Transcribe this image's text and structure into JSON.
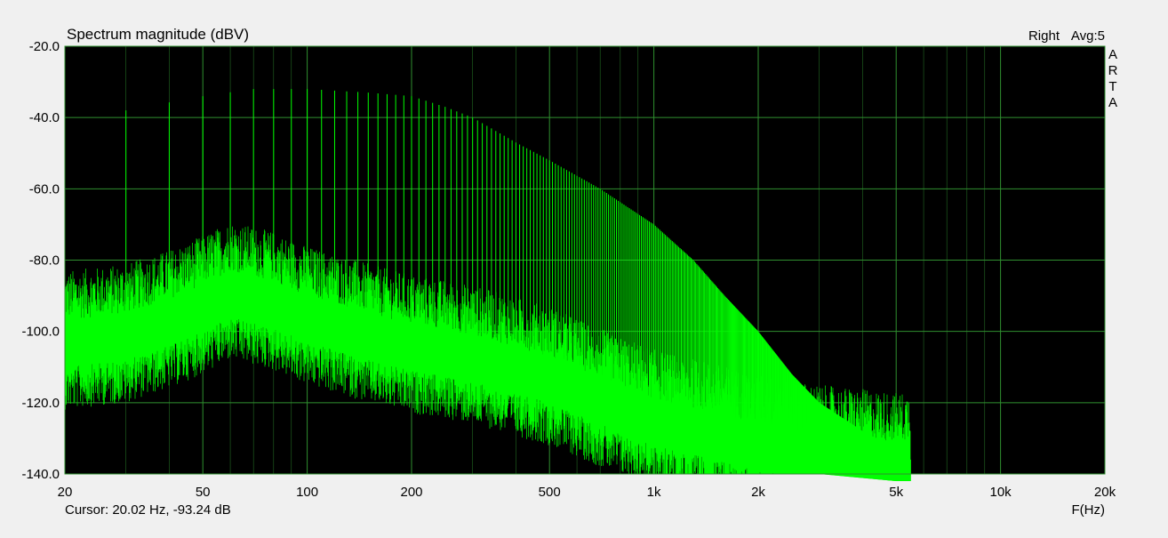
{
  "chart_data": {
    "type": "line",
    "title": "Spectrum magnitude (dBV)",
    "channel_label": "Right",
    "avg_label": "Avg:5",
    "brand_letters": [
      "A",
      "R",
      "T",
      "A"
    ],
    "xlabel": "F(Hz)",
    "ylabel": "",
    "x_scale": "log",
    "xlim": [
      20,
      20000
    ],
    "ylim": [
      -140,
      -20
    ],
    "x_ticks": [
      {
        "value": 20,
        "label": "20"
      },
      {
        "value": 50,
        "label": "50"
      },
      {
        "value": 100,
        "label": "100"
      },
      {
        "value": 200,
        "label": "200"
      },
      {
        "value": 500,
        "label": "500"
      },
      {
        "value": 1000,
        "label": "1k"
      },
      {
        "value": 2000,
        "label": "2k"
      },
      {
        "value": 5000,
        "label": "5k"
      },
      {
        "value": 10000,
        "label": "10k"
      },
      {
        "value": 20000,
        "label": "20k"
      }
    ],
    "y_ticks": [
      {
        "value": -20,
        "label": "-20.0"
      },
      {
        "value": -40,
        "label": "-40.0"
      },
      {
        "value": -60,
        "label": "-60.0"
      },
      {
        "value": -80,
        "label": "-80.0"
      },
      {
        "value": -100,
        "label": "-100.0"
      },
      {
        "value": -120,
        "label": "-120.0"
      },
      {
        "value": -140,
        "label": "-140.0"
      }
    ],
    "grid": true,
    "colors": {
      "plot_bg": "#000000",
      "grid": "#2f8f2f",
      "trace": "#00ff00",
      "figure_bg": "#f0f0f0"
    },
    "cursor_text": "Cursor: 20.02 Hz, -93.24 dB",
    "series": [
      {
        "harmonic_spacing_hz": 10,
        "harmonic_range_hz": [
          20,
          5500
        ],
        "harmonic_envelope": [
          [
            20,
            -40
          ],
          [
            30,
            -38
          ],
          [
            50,
            -34
          ],
          [
            70,
            -32
          ],
          [
            100,
            -32
          ],
          [
            150,
            -33
          ],
          [
            200,
            -34
          ],
          [
            250,
            -37
          ],
          [
            300,
            -40
          ],
          [
            400,
            -47
          ],
          [
            500,
            -52
          ],
          [
            700,
            -60
          ],
          [
            1000,
            -70
          ],
          [
            1300,
            -80
          ],
          [
            1600,
            -90
          ],
          [
            2000,
            -100
          ],
          [
            2500,
            -112
          ],
          [
            3000,
            -120
          ],
          [
            4000,
            -128
          ],
          [
            5000,
            -133
          ],
          [
            5500,
            -136
          ]
        ],
        "noise_floor": [
          [
            20,
            -102
          ],
          [
            30,
            -100
          ],
          [
            40,
            -96
          ],
          [
            50,
            -92
          ],
          [
            60,
            -88
          ],
          [
            80,
            -91
          ],
          [
            100,
            -95
          ],
          [
            150,
            -100
          ],
          [
            200,
            -103
          ],
          [
            300,
            -106
          ],
          [
            500,
            -112
          ],
          [
            700,
            -118
          ],
          [
            1000,
            -124
          ],
          [
            1500,
            -128
          ],
          [
            2000,
            -131
          ],
          [
            3000,
            -134
          ],
          [
            5000,
            -136
          ],
          [
            5500,
            -136
          ]
        ]
      }
    ]
  }
}
